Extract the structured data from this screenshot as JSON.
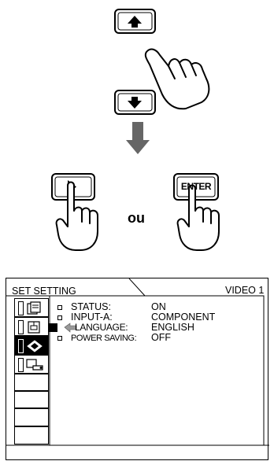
{
  "illustration": {
    "connector_word": "ou",
    "enter_key_label": "ENTER"
  },
  "menu": {
    "tab_title": "SET SETTING",
    "input_indicator": "VIDEO 1",
    "items": [
      {
        "label": "STATUS:",
        "value": "ON",
        "selected": false
      },
      {
        "label": "INPUT-A:",
        "value": "COMPONENT",
        "selected": false
      },
      {
        "label": "LANGUAGE:",
        "value": "ENGLISH",
        "selected": true
      },
      {
        "label": "POWER SAVING:",
        "value": "OFF",
        "selected": false
      }
    ]
  }
}
